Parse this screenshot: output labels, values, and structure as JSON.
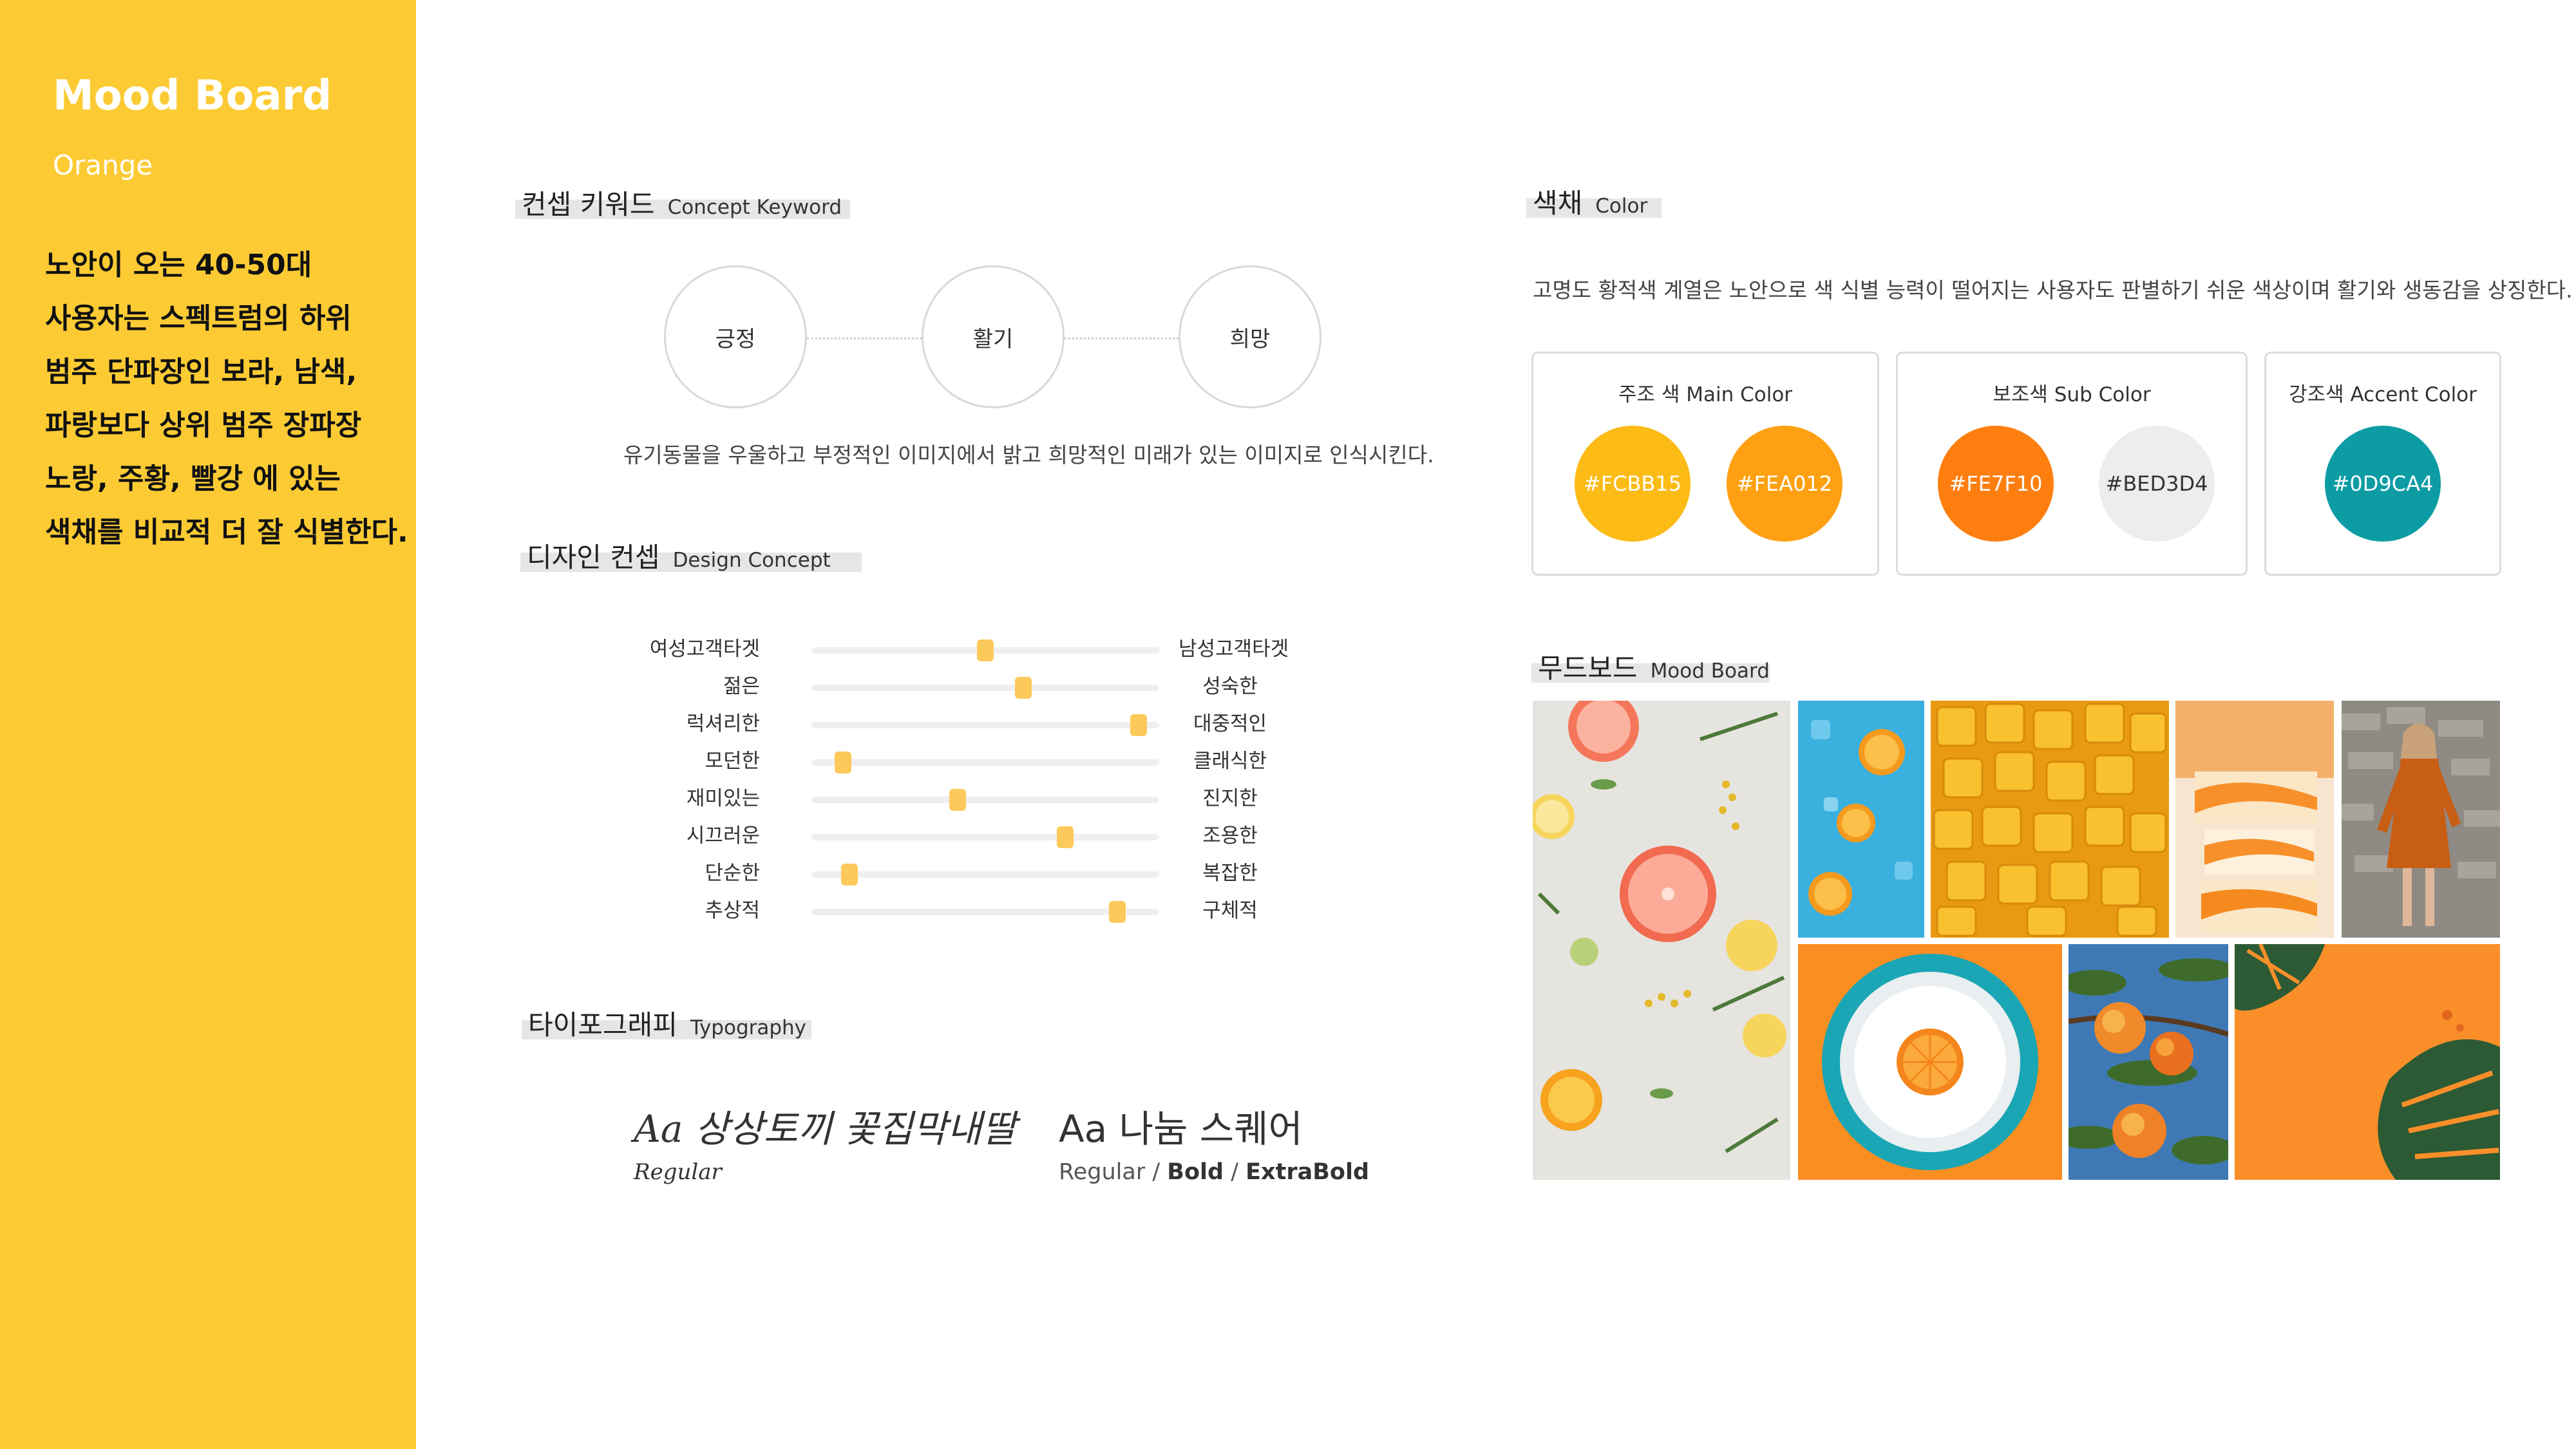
{
  "sidebar": {
    "title": "Mood Board",
    "subtitle": "Orange",
    "description": [
      "노안이 오는 40-50대",
      "사용자는  스펙트럼의 하위",
      "범주 단파장인 보라, 남색,",
      "파랑보다 상위 범주 장파장",
      "노랑, 주황, 빨강 에 있는",
      "색채를 비교적 더 잘 식별한다."
    ]
  },
  "concept": {
    "header_ko": "컨셉 키워드",
    "header_en": "Concept Keyword",
    "keywords": [
      "긍정",
      "활기",
      "희망"
    ],
    "description": "유기동물을 우울하고 부정적인 이미지에서 밝고 희망적인 미래가 있는 이미지로 인식시킨다."
  },
  "design": {
    "header_ko": "디자인 컨셉",
    "header_en": "Design Concept",
    "sliders": [
      {
        "left": "여성고객타겟",
        "right": "남성고객타겟",
        "value": 0.5
      },
      {
        "left": "젊은",
        "right": "성숙한",
        "value": 0.61
      },
      {
        "left": "럭셔리한",
        "right": "대중적인",
        "value": 0.94
      },
      {
        "left": "모던한",
        "right": "클래식한",
        "value": 0.09
      },
      {
        "left": "재미있는",
        "right": "진지한",
        "value": 0.42
      },
      {
        "left": "시끄러운",
        "right": "조용한",
        "value": 0.73
      },
      {
        "left": "단순한",
        "right": "복잡한",
        "value": 0.11
      },
      {
        "left": "추상적",
        "right": "구체적",
        "value": 0.88
      }
    ]
  },
  "typography": {
    "header_ko": "타이포그래피",
    "header_en": "Typography",
    "font1": {
      "name": "Aa 상상토끼 꽃집막내딸",
      "weights": "Regular"
    },
    "font2": {
      "name": "Aa 나눔 스퀘어",
      "w1": "Regular",
      "sep1": " / ",
      "w2": "Bold",
      "sep2": " / ",
      "w3": "ExtraBold"
    }
  },
  "color": {
    "header_ko": "색채",
    "header_en": "Color",
    "description": "고명도 황적색 계열은 노안으로 색 식별 능력이 떨어지는 사용자도 판별하기 쉬운 색상이며 활기와 생동감을 상징한다.",
    "main": {
      "caption": "주조 색 Main Color",
      "colors": [
        "#FCBB15",
        "#FEA012"
      ]
    },
    "sub": {
      "caption": "보조색 Sub Color",
      "colors": [
        "#FE7F10",
        "#BED3D4"
      ]
    },
    "accent": {
      "caption": "강조색 Accent Color",
      "colors": [
        "#0D9CA4"
      ]
    },
    "swatch_fill": {
      "main1": "#fcbb15",
      "main2": "#fea012",
      "sub1": "#fe7f10",
      "sub2": "#eeeced",
      "accent1": "#0d9ca4"
    }
  },
  "moodboard": {
    "header_ko": "무드보드",
    "header_en": "Mood Board"
  }
}
